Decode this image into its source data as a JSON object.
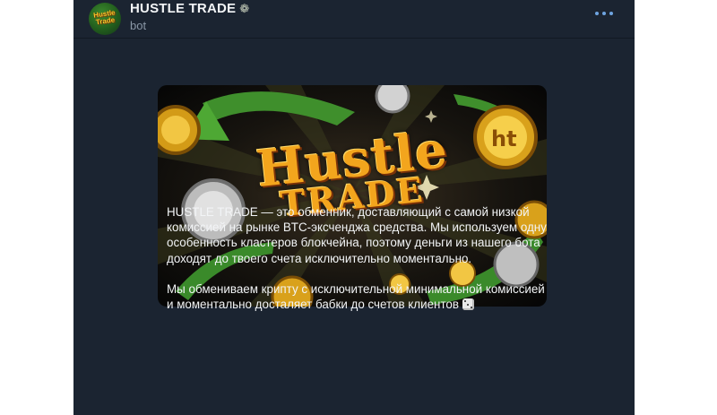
{
  "header": {
    "title": "HUSTLE TRADE",
    "title_emoji": "❁",
    "subtitle": "bot",
    "avatar_text_top": "Hustle",
    "avatar_text_bottom": "Trade",
    "menu_icon": "more-horizontal-icon",
    "accent_color": "#6ea4e0"
  },
  "banner": {
    "line1": "Hustle",
    "line2": "TRADE",
    "badge": "ht"
  },
  "message": {
    "paragraph1": "HUSTLE TRADE — это обменник, доставляющий с самой низкой комиссией на рынке BTC-эксченджа средства. Мы используем одну особенность кластеров блокчейна, поэтому деньги из нашего бота доходят до твоего счета исключительно моментально.",
    "paragraph2": "Мы обмениваем крипту с исключительной минимальной комиссией и моментально досталяет бабки до счетов клиентов",
    "emoji": "dice-icon"
  },
  "colors": {
    "background": "#1b2431",
    "text": "#f2f4f6",
    "subtitle": "#8a97a6"
  }
}
